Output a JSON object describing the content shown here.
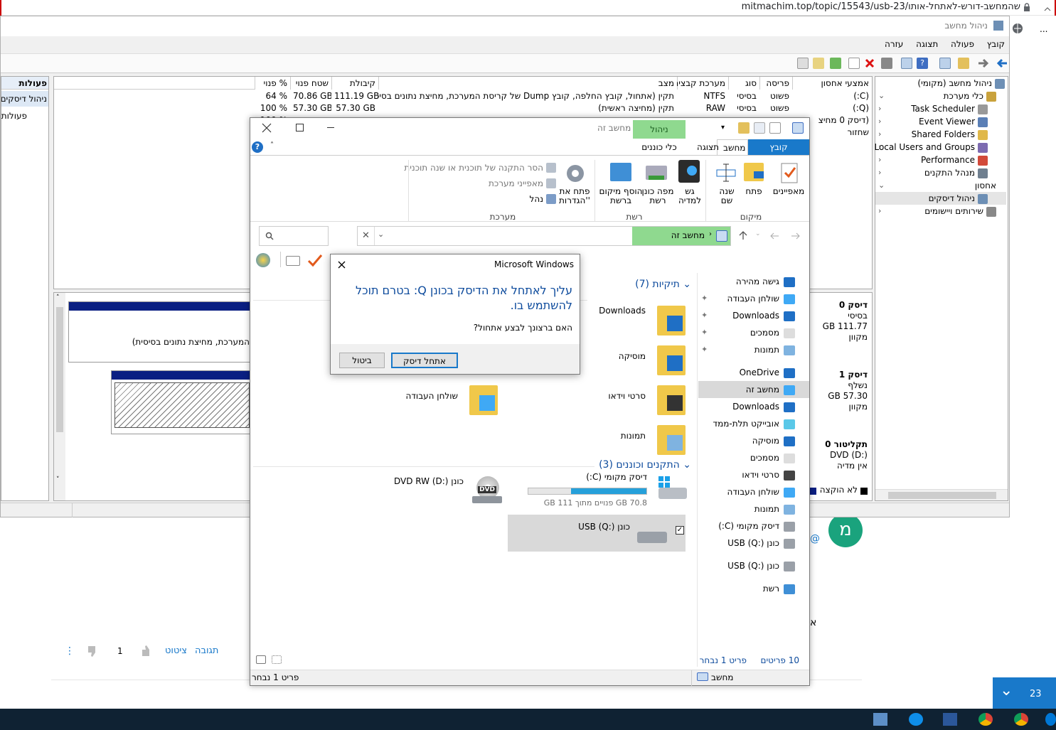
{
  "browser": {
    "url": "mitmachim.top/topic/15543/usb-23/שהמחשב-דורש-לאתחל-אותו",
    "left_text": "...",
    "side_number": "23"
  },
  "cm": {
    "title": "ניהול מחשב",
    "menu": [
      "קובץ",
      "פעולה",
      "תצוגה",
      "עזרה"
    ],
    "tree": [
      {
        "label": "ניהול מחשב (מקומי)",
        "icon": "computer-icon"
      },
      {
        "label": "כלי מערכת",
        "icon": "tools-icon"
      },
      {
        "label": "Task Scheduler",
        "icon": "clock-icon"
      },
      {
        "label": "Event Viewer",
        "icon": "event-viewer-icon"
      },
      {
        "label": "Shared Folders",
        "icon": "shared-folder-icon"
      },
      {
        "label": "Local Users and Groups",
        "icon": "users-icon"
      },
      {
        "label": "Performance",
        "icon": "performance-icon"
      },
      {
        "label": "מנהל התקנים",
        "icon": "device-manager-icon"
      },
      {
        "label": "אחסון",
        "icon": ""
      },
      {
        "label": "ניהול דיסקים",
        "icon": "disk-management-icon"
      },
      {
        "label": "שירותים ויישומים",
        "icon": "services-icon"
      }
    ],
    "columns": [
      "אמצעי אחסון",
      "פריסה",
      "סוג",
      "מערכת קבצים",
      "מצב",
      "קיבולת",
      "שטח פנוי",
      "% פנוי"
    ],
    "volumes": [
      {
        "name": "(C:)",
        "layout": "פשוט",
        "type": "בסיסי",
        "fs": "NTFS",
        "status": "תקין (אתחול, קובץ החלפה, קובץ Dump של קריסת המערכת, מחיצת נתונים בסיסית)",
        "capacity": "111.19 GB",
        "free": "70.86 GB",
        "pct": "64 %"
      },
      {
        "name": "(Q:)",
        "layout": "פשוט",
        "type": "בסיסי",
        "fs": "RAW",
        "status": "תקין (מחיצה ראשית)",
        "capacity": "57.30 GB",
        "free": "57.30 GB",
        "pct": "100 %"
      },
      {
        "name": "(דיסק 0 מחיצ",
        "layout": "",
        "type": "",
        "fs": "",
        "status": "",
        "capacity": "",
        "free": "",
        "pct": "100 %"
      },
      {
        "name": "שחזור",
        "layout": "",
        "type": "",
        "fs": "",
        "status": "",
        "capacity": "",
        "free": "",
        "pct": "%"
      }
    ],
    "actions_title": "פעולות",
    "actions": [
      "ניהול דיסקים",
      "פעולות"
    ],
    "disks": [
      {
        "title": "דיסק 0",
        "line1": "בסיסי",
        "line2": "111.77 GB",
        "line3": "מקוון"
      },
      {
        "title": "דיסק 1",
        "line1": "נשלף",
        "line2": "57.30 GB",
        "line3": "מקוון"
      },
      {
        "title": "תקליטור 0",
        "line1": "DVD (D:)",
        "line2": "",
        "line3": "אין מדיה"
      }
    ],
    "partition_text": "המערכת, מחיצת נתונים בסיסית)",
    "legend_unallocated": "לא הוקצה"
  },
  "explorer": {
    "title": "מחשב זה",
    "manage_tab": "ניהול",
    "tabs": [
      "קובץ",
      "מחשב",
      "תצוגה",
      "כלי כוננים"
    ],
    "ribbon": {
      "location_group": "מיקום",
      "network_group": "רשת",
      "system_group": "מערכת",
      "properties": "מאפיינים",
      "open": "פתח",
      "rename": "שנה שם",
      "media": "גש למדיה",
      "map_drive": "מפה כונן רשת",
      "add_location": "הוסף מיקום ברשת",
      "open_settings": "פתח את 'הגדרות'",
      "uninstall": "הסר התקנה של תוכנית או שנה תוכנית",
      "sys_props": "מאפייני מערכת",
      "manage": "נהל"
    },
    "address": "מחשב זה",
    "nav": [
      {
        "label": "גישה מהירה",
        "icon": "star-icon"
      },
      {
        "label": "שולחן העבודה",
        "icon": "desktop-icon"
      },
      {
        "label": "Downloads",
        "icon": "download-icon"
      },
      {
        "label": "מסמכים",
        "icon": "documents-icon"
      },
      {
        "label": "תמונות",
        "icon": "pictures-icon"
      },
      {
        "label": "OneDrive",
        "icon": "cloud-icon"
      },
      {
        "label": "מחשב זה",
        "icon": "this-pc-icon"
      },
      {
        "label": "Downloads",
        "icon": "download-icon"
      },
      {
        "label": "אובייקט תלת-ממד",
        "icon": "3d-objects-icon"
      },
      {
        "label": "מוסיקה",
        "icon": "music-icon"
      },
      {
        "label": "מסמכים",
        "icon": "documents-icon"
      },
      {
        "label": "סרטי וידאו",
        "icon": "video-icon"
      },
      {
        "label": "שולחן העבודה",
        "icon": "desktop-icon"
      },
      {
        "label": "תמונות",
        "icon": "pictures-icon"
      },
      {
        "label": "דיסק מקומי (C:)",
        "icon": "drive-icon"
      },
      {
        "label": "כונן USB (Q:)",
        "icon": "usb-drive-icon"
      },
      {
        "label": "כונן USB (Q:)",
        "icon": "usb-drive-icon"
      },
      {
        "label": "רשת",
        "icon": "network-icon"
      }
    ],
    "folders_header": "תיקיות (7)",
    "folders": [
      "Downloads",
      "מוסיקה",
      "סרטי וידאו",
      "תמונות",
      "שולחן העבודה"
    ],
    "devices_header": "התקנים וכוננים (3)",
    "drive_c": {
      "label": "דיסק מקומי (C:)",
      "space": "70.8 GB פנויים מתוך 111 GB",
      "used_fraction": 0.36
    },
    "drive_d": {
      "label": "כונן DVD RW (D:)",
      "dvd_text": "DVD"
    },
    "drive_q": {
      "label": "כונן USB (Q:)"
    },
    "status_items": "10 פריטים",
    "status_selected": "פריט 1 נבחר",
    "bottom_left": "פריט 1 נבחר",
    "bottom_right": "מחשב"
  },
  "dialog": {
    "title": "Microsoft Windows",
    "message": "עליך לאתחל את הדיסק בכונן Q: בטרם תוכל להשתמש בו.",
    "question": "האם ברצונך לבצע אתחול?",
    "format_btn": "אתחל דיסק",
    "cancel_btn": "ביטול"
  },
  "forum": {
    "avatar_letter": "מ",
    "reply": "תגובה",
    "quote": "ציטוט",
    "votes": "1",
    "at": "@",
    "letter": "א"
  },
  "colors": {
    "accent": "#1979ca",
    "title_blue": "#0c4a9c",
    "green": "#8fd98f",
    "avatar": "#1aa37d"
  }
}
